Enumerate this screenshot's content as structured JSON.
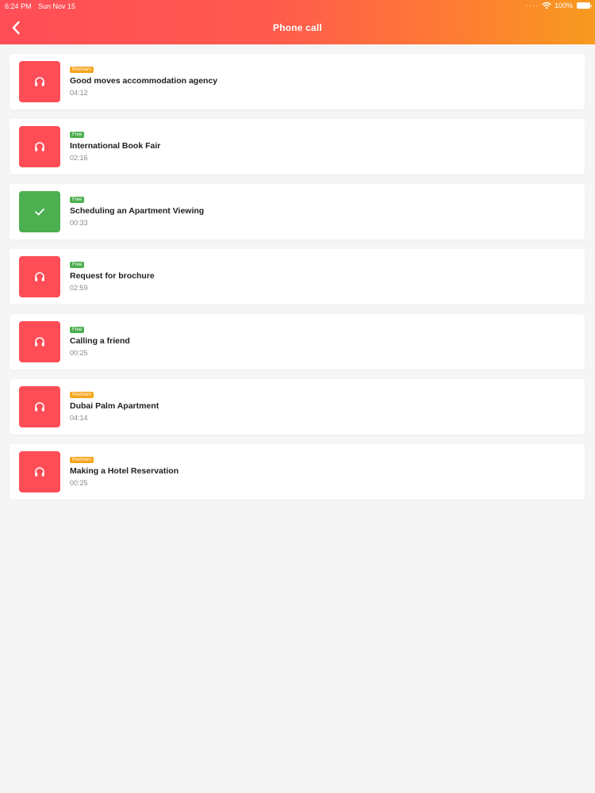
{
  "status_bar": {
    "time": "6:24 PM",
    "date": "Sun Nov 15",
    "battery": "100%"
  },
  "header": {
    "title": "Phone call",
    "back_icon": "chevron-left-icon"
  },
  "colors": {
    "premium": "#f5a51c",
    "free": "#4caf50",
    "thumb_default": "#ff4d57",
    "thumb_completed": "#4caf50"
  },
  "calls": [
    {
      "badge": "Premium",
      "badge_type": "premium",
      "title": "Good moves accommodation agency",
      "duration": "04:12",
      "icon": "headphones-icon",
      "completed": false
    },
    {
      "badge": "Free",
      "badge_type": "free",
      "title": "International Book Fair",
      "duration": "02:16",
      "icon": "headphones-icon",
      "completed": false
    },
    {
      "badge": "Free",
      "badge_type": "free",
      "title": "Scheduling an Apartment Viewing",
      "duration": "00:33",
      "icon": "check-icon",
      "completed": true
    },
    {
      "badge": "Free",
      "badge_type": "free",
      "title": "Request for brochure",
      "duration": "02:59",
      "icon": "headphones-icon",
      "completed": false
    },
    {
      "badge": "Free",
      "badge_type": "free",
      "title": "Calling a friend",
      "duration": "00:25",
      "icon": "headphones-icon",
      "completed": false
    },
    {
      "badge": "Premium",
      "badge_type": "premium",
      "title": "Dubai Palm Apartment",
      "duration": "04:14",
      "icon": "headphones-icon",
      "completed": false
    },
    {
      "badge": "Premium",
      "badge_type": "premium",
      "title": "Making a Hotel Reservation",
      "duration": "00:25",
      "icon": "headphones-icon",
      "completed": false
    }
  ]
}
